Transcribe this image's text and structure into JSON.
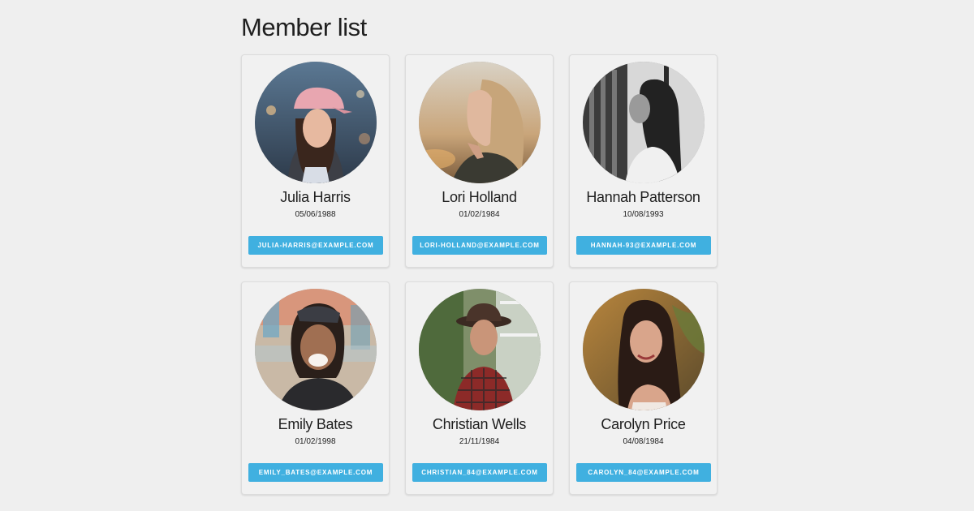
{
  "page": {
    "title": "Member list"
  },
  "members": [
    {
      "name": "Julia Harris",
      "dob": "05/06/1988",
      "email": "JULIA-HARRIS@EXAMPLE.COM",
      "photo_desc": "woman-pink-cap"
    },
    {
      "name": "Lori Holland",
      "dob": "01/02/1984",
      "email": "LORI-HOLLAND@EXAMPLE.COM",
      "photo_desc": "woman-profile-sunset"
    },
    {
      "name": "Hannah Patterson",
      "dob": "10/08/1993",
      "email": "HANNAH-93@EXAMPLE.COM",
      "photo_desc": "woman-bw-window"
    },
    {
      "name": "Emily Bates",
      "dob": "01/02/1998",
      "email": "EMILY_BATES@EXAMPLE.COM",
      "photo_desc": "woman-laughing-cap"
    },
    {
      "name": "Christian Wells",
      "dob": "21/11/1984",
      "email": "CHRISTIAN_84@EXAMPLE.COM",
      "photo_desc": "man-hat-plaid"
    },
    {
      "name": "Carolyn Price",
      "dob": "04/08/1984",
      "email": "CAROLYN_84@EXAMPLE.COM",
      "photo_desc": "woman-long-hair-palms"
    }
  ],
  "colors": {
    "background": "#efefef",
    "card": "#f1f1f1",
    "accent": "#40b0e0"
  }
}
